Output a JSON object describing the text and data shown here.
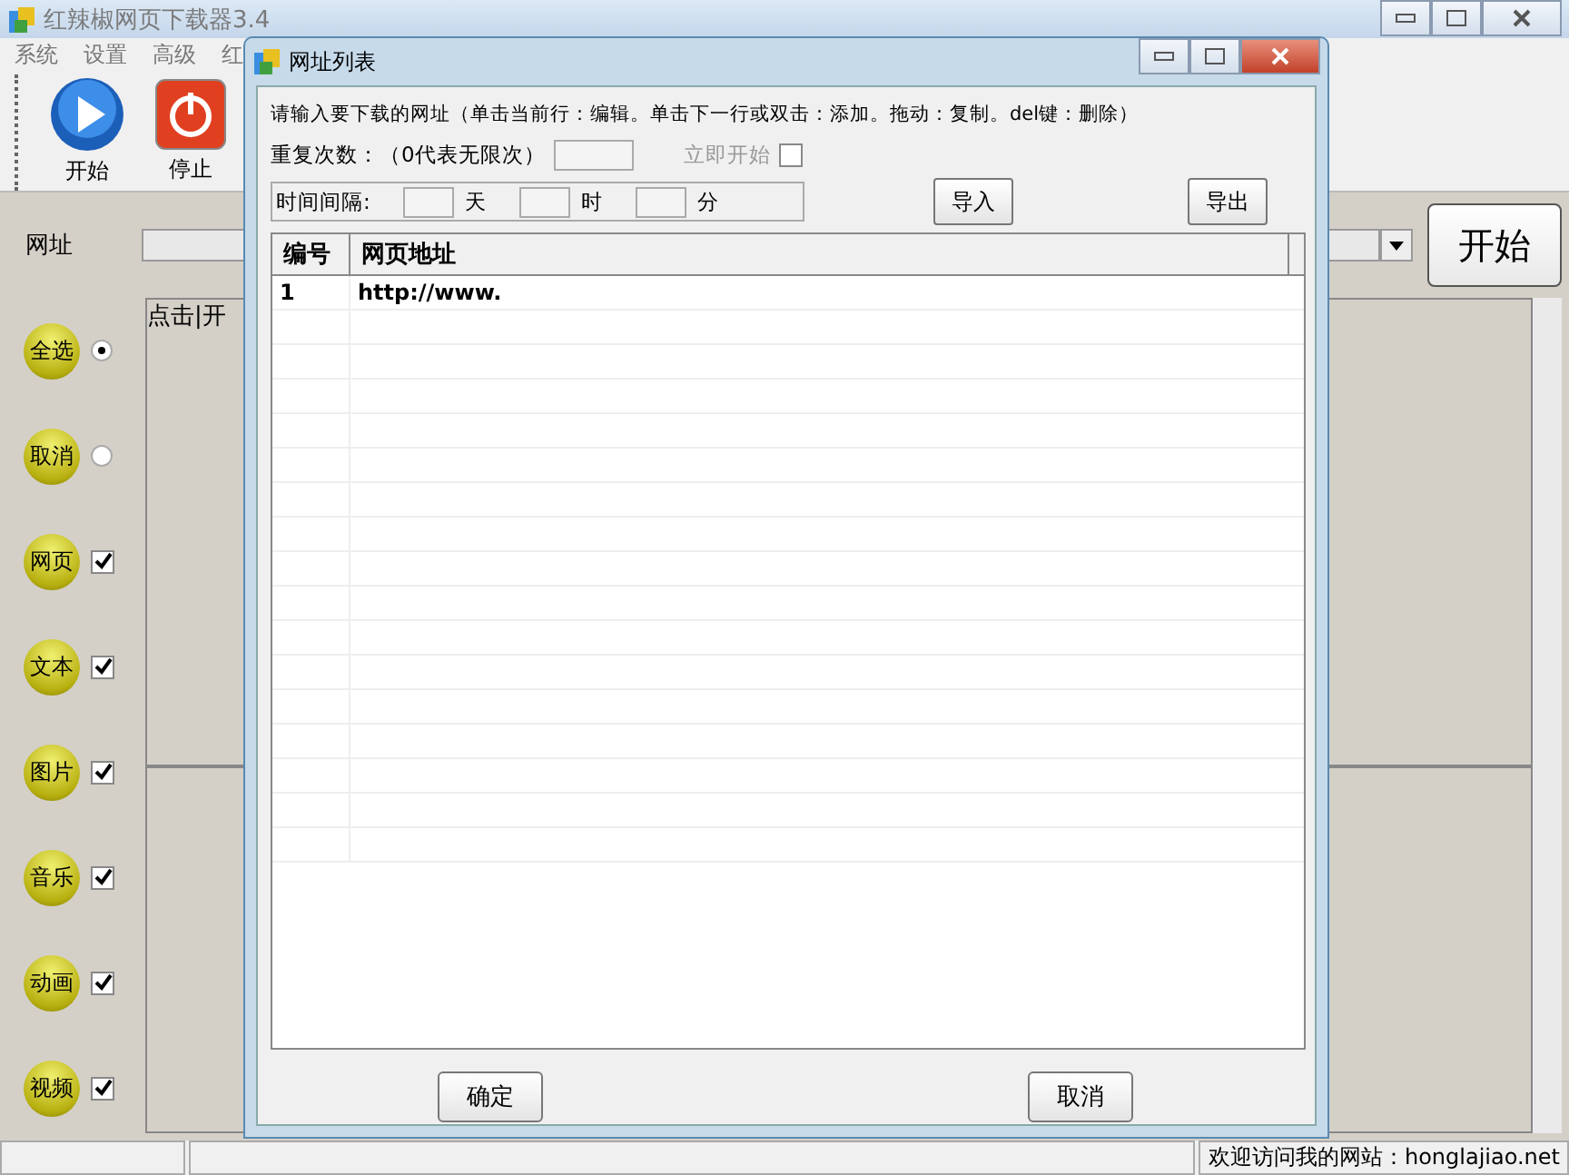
{
  "window": {
    "title": "红辣椒网页下载器3.4"
  },
  "menu": [
    "系统",
    "设置",
    "高级",
    "红"
  ],
  "toolbar": [
    {
      "kind": "play",
      "label": "开始"
    },
    {
      "kind": "power",
      "label": "停止"
    }
  ],
  "url_label": "网址",
  "start_button": "开始",
  "options": [
    {
      "label": "全选",
      "kind": "radio",
      "checked": true
    },
    {
      "label": "取消",
      "kind": "radio",
      "checked": false
    },
    {
      "label": "网页",
      "kind": "checkbox",
      "checked": true
    },
    {
      "label": "文本",
      "kind": "checkbox",
      "checked": true
    },
    {
      "label": "图片",
      "kind": "checkbox",
      "checked": true
    },
    {
      "label": "音乐",
      "kind": "checkbox",
      "checked": true
    },
    {
      "label": "动画",
      "kind": "checkbox",
      "checked": true
    },
    {
      "label": "视频",
      "kind": "checkbox",
      "checked": true
    }
  ],
  "log_text": "点击|开",
  "status_bar": "欢迎访问我的网站：honglajiao.net",
  "dialog": {
    "title": "网址列表",
    "instructions": "请输入要下载的网址（单击当前行：编辑。单击下一行或双击：添加。拖动：复制。del键：删除）",
    "repeat_label": "重复次数：（0代表无限次）",
    "start_now": {
      "label": "立即开始",
      "checked": false,
      "disabled": true
    },
    "interval_label": "时间间隔:",
    "units": [
      "天",
      "时",
      "分"
    ],
    "import_button": "导入",
    "export_button": "导出",
    "table": {
      "columns": [
        "编号",
        "网页地址"
      ],
      "rows": [
        [
          "1",
          "http://www."
        ]
      ]
    },
    "ok_button": "确定",
    "cancel_button": "取消"
  }
}
